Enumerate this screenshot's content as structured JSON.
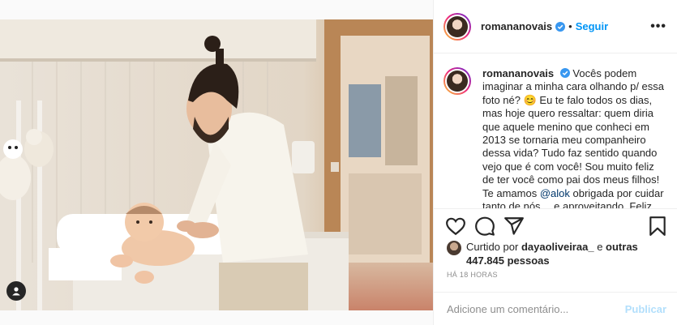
{
  "post": {
    "author": "romananovais",
    "follow_label": "Seguir",
    "separator": "•",
    "more_label": "•••"
  },
  "caption": {
    "author": "romananovais",
    "text_before_mention": "Vocês podem imaginar a minha cara olhando p/ essa foto né? 😊 Eu te falo todos os dias, mas hoje quero ressaltar: quem diria que aquele menino que conheci em 2013 se tornaria meu companheiro dessa vida? Tudo faz sentido quando vejo que é com você! Sou muito feliz de ter você como pai dos meus filhos! Te amamos",
    "mention": "@alok",
    "text_after_mention": "obrigada por cuidar tanto de nós… e aproveitando. Feliz"
  },
  "likes": {
    "prefix": "Curtido por",
    "user": "dayaoliveiraa_",
    "connector": "e",
    "others": "outras 447.845 pessoas"
  },
  "timestamp": "HÁ 18 HORAS",
  "comment_box": {
    "placeholder": "Adicione um comentário...",
    "publish_label": "Publicar"
  },
  "colors": {
    "accent": "#0095f6",
    "publish_disabled": "#b2dffc",
    "mention": "#00376b"
  },
  "icons": [
    "heart-icon",
    "comment-icon",
    "share-icon",
    "bookmark-icon",
    "verified-icon",
    "user-tag-icon"
  ]
}
